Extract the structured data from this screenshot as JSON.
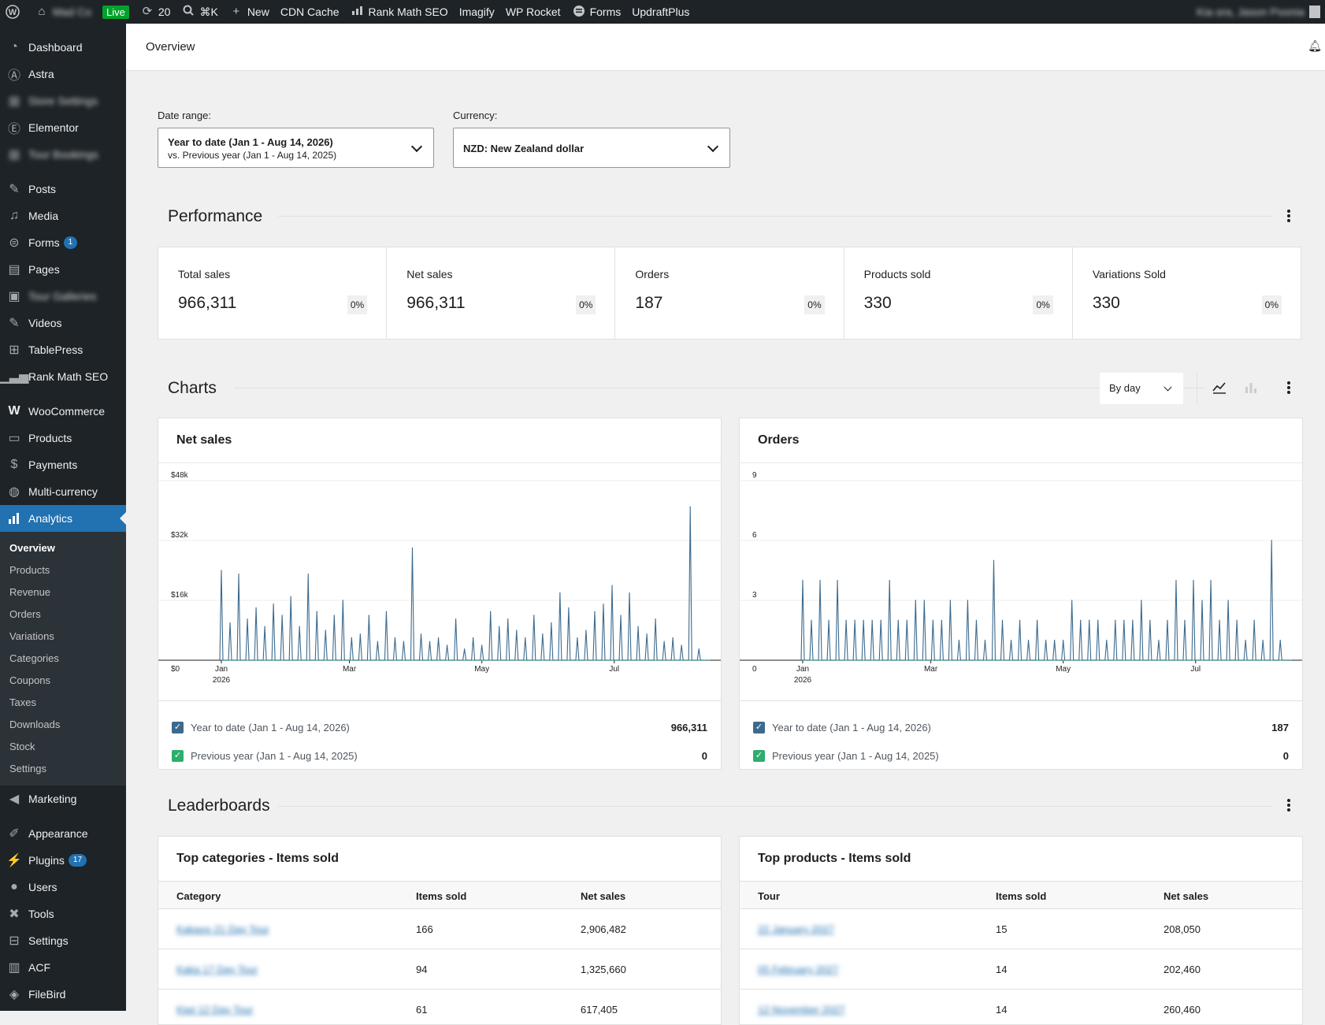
{
  "admin_bar": {
    "site_name": "Mad Co",
    "live_label": "Live",
    "updates_count": "20",
    "search_shortcut": "⌘K",
    "new_label": "New",
    "cdn_cache_label": "CDN Cache",
    "rank_math_label": "Rank Math SEO",
    "imagify_label": "Imagify",
    "wp_rocket_label": "WP Rocket",
    "forms_label": "Forms",
    "updraft_label": "UpdraftPlus",
    "greeting": "Kia ora, Jason Poonia"
  },
  "sidebar": {
    "dashboard": "Dashboard",
    "astra": "Astra",
    "store_settings": "Store Settings",
    "elementor": "Elementor",
    "tour_bookings": "Tour Bookings",
    "posts": "Posts",
    "media": "Media",
    "forms": "Forms",
    "forms_count": "1",
    "pages": "Pages",
    "tour_galleries": "Tour Galleries",
    "videos": "Videos",
    "tablepress": "TablePress",
    "rank_math": "Rank Math SEO",
    "woocommerce": "WooCommerce",
    "products": "Products",
    "payments": "Payments",
    "multi_currency": "Multi-currency",
    "analytics": "Analytics",
    "submenu": [
      "Overview",
      "Products",
      "Revenue",
      "Orders",
      "Variations",
      "Categories",
      "Coupons",
      "Taxes",
      "Downloads",
      "Stock",
      "Settings"
    ],
    "marketing": "Marketing",
    "appearance": "Appearance",
    "plugins": "Plugins",
    "plugins_count": "17",
    "users": "Users",
    "tools": "Tools",
    "settings": "Settings",
    "acf": "ACF",
    "filebird": "FileBird"
  },
  "header": {
    "title": "Overview"
  },
  "filters": {
    "date_range_label": "Date range:",
    "date_range_line1": "Year to date (Jan 1 - Aug 14, 2026)",
    "date_range_line2": "vs. Previous year (Jan 1 - Aug 14, 2025)",
    "currency_label": "Currency:",
    "currency_value": "NZD: New Zealand dollar"
  },
  "performance": {
    "title": "Performance",
    "cards": [
      {
        "label": "Total sales",
        "value": "966,311",
        "delta": "0%"
      },
      {
        "label": "Net sales",
        "value": "966,311",
        "delta": "0%"
      },
      {
        "label": "Orders",
        "value": "187",
        "delta": "0%"
      },
      {
        "label": "Products sold",
        "value": "330",
        "delta": "0%"
      },
      {
        "label": "Variations Sold",
        "value": "330",
        "delta": "0%"
      }
    ]
  },
  "charts": {
    "title": "Charts",
    "interval": "By day",
    "colors": {
      "current": "#3c6a8e",
      "previous": "#2dae6c"
    },
    "net_sales": {
      "title": "Net sales",
      "legend_current": "Year to date (Jan 1 - Aug 14, 2026)",
      "legend_current_value": "966,311",
      "legend_previous": "Previous year (Jan 1 - Aug 14, 2025)",
      "legend_previous_value": "0"
    },
    "orders": {
      "title": "Orders",
      "legend_current": "Year to date (Jan 1 - Aug 14, 2026)",
      "legend_current_value": "187",
      "legend_previous": "Previous year (Jan 1 - Aug 14, 2025)",
      "legend_previous_value": "0"
    }
  },
  "chart_data": [
    {
      "type": "line",
      "title": "Net sales",
      "xlabel": "",
      "ylabel": "",
      "y_ticks": [
        "$0",
        "$16k",
        "$32k",
        "$48k"
      ],
      "ylim": [
        0,
        48000
      ],
      "x_ticks": [
        "Jan 2026",
        "Mar",
        "May",
        "Jul"
      ],
      "x_range": [
        "2026-01-01",
        "2026-08-14"
      ],
      "grid": true,
      "series": [
        {
          "name": "Year to date (Jan 1 - Aug 14, 2026)",
          "color": "#3c6a8e",
          "total": "966,311",
          "peaks": [
            {
              "x": "2026-01-01",
              "y": 24000
            },
            {
              "x": "2026-01-05",
              "y": 10000
            },
            {
              "x": "2026-01-09",
              "y": 23000
            },
            {
              "x": "2026-01-13",
              "y": 11000
            },
            {
              "x": "2026-01-17",
              "y": 14000
            },
            {
              "x": "2026-01-21",
              "y": 9000
            },
            {
              "x": "2026-01-25",
              "y": 15000
            },
            {
              "x": "2026-01-29",
              "y": 12000
            },
            {
              "x": "2026-02-02",
              "y": 17000
            },
            {
              "x": "2026-02-06",
              "y": 9000
            },
            {
              "x": "2026-02-10",
              "y": 23000
            },
            {
              "x": "2026-02-14",
              "y": 13000
            },
            {
              "x": "2026-02-18",
              "y": 8000
            },
            {
              "x": "2026-02-22",
              "y": 12000
            },
            {
              "x": "2026-02-26",
              "y": 16000
            },
            {
              "x": "2026-03-02",
              "y": 6000
            },
            {
              "x": "2026-03-06",
              "y": 7000
            },
            {
              "x": "2026-03-10",
              "y": 12000
            },
            {
              "x": "2026-03-14",
              "y": 5000
            },
            {
              "x": "2026-03-18",
              "y": 13000
            },
            {
              "x": "2026-03-22",
              "y": 6000
            },
            {
              "x": "2026-03-26",
              "y": 5000
            },
            {
              "x": "2026-03-30",
              "y": 30000
            },
            {
              "x": "2026-04-03",
              "y": 7000
            },
            {
              "x": "2026-04-07",
              "y": 5000
            },
            {
              "x": "2026-04-11",
              "y": 6000
            },
            {
              "x": "2026-04-15",
              "y": 4000
            },
            {
              "x": "2026-04-19",
              "y": 11000
            },
            {
              "x": "2026-04-23",
              "y": 3000
            },
            {
              "x": "2026-04-27",
              "y": 6000
            },
            {
              "x": "2026-05-01",
              "y": 4000
            },
            {
              "x": "2026-05-05",
              "y": 13000
            },
            {
              "x": "2026-05-09",
              "y": 9000
            },
            {
              "x": "2026-05-13",
              "y": 11000
            },
            {
              "x": "2026-05-17",
              "y": 8000
            },
            {
              "x": "2026-05-21",
              "y": 6000
            },
            {
              "x": "2026-05-25",
              "y": 12000
            },
            {
              "x": "2026-05-29",
              "y": 7000
            },
            {
              "x": "2026-06-02",
              "y": 10000
            },
            {
              "x": "2026-06-06",
              "y": 18000
            },
            {
              "x": "2026-06-10",
              "y": 14000
            },
            {
              "x": "2026-06-14",
              "y": 6000
            },
            {
              "x": "2026-06-18",
              "y": 8000
            },
            {
              "x": "2026-06-22",
              "y": 13000
            },
            {
              "x": "2026-06-26",
              "y": 15000
            },
            {
              "x": "2026-06-30",
              "y": 20000
            },
            {
              "x": "2026-07-04",
              "y": 12000
            },
            {
              "x": "2026-07-08",
              "y": 18000
            },
            {
              "x": "2026-07-12",
              "y": 9000
            },
            {
              "x": "2026-07-16",
              "y": 7000
            },
            {
              "x": "2026-07-20",
              "y": 11000
            },
            {
              "x": "2026-07-24",
              "y": 5000
            },
            {
              "x": "2026-07-28",
              "y": 6000
            },
            {
              "x": "2026-08-01",
              "y": 4000
            },
            {
              "x": "2026-08-05",
              "y": 41000
            },
            {
              "x": "2026-08-09",
              "y": 3000
            },
            {
              "x": "2026-08-13",
              "y": 0
            }
          ]
        },
        {
          "name": "Previous year (Jan 1 - Aug 14, 2025)",
          "color": "#2dae6c",
          "total": "0",
          "constant": 0
        }
      ]
    },
    {
      "type": "line",
      "title": "Orders",
      "xlabel": "",
      "ylabel": "",
      "y_ticks": [
        "0",
        "3",
        "6",
        "9"
      ],
      "ylim": [
        0,
        9
      ],
      "x_ticks": [
        "Jan 2026",
        "Mar",
        "May",
        "Jul"
      ],
      "x_range": [
        "2026-01-01",
        "2026-08-14"
      ],
      "grid": true,
      "series": [
        {
          "name": "Year to date (Jan 1 - Aug 14, 2026)",
          "color": "#3c6a8e",
          "total": "187",
          "peaks": [
            {
              "x": "2026-01-01",
              "y": 4
            },
            {
              "x": "2026-01-05",
              "y": 2
            },
            {
              "x": "2026-01-09",
              "y": 4
            },
            {
              "x": "2026-01-13",
              "y": 2
            },
            {
              "x": "2026-01-17",
              "y": 4
            },
            {
              "x": "2026-01-21",
              "y": 2
            },
            {
              "x": "2026-01-25",
              "y": 2
            },
            {
              "x": "2026-01-29",
              "y": 2
            },
            {
              "x": "2026-02-02",
              "y": 2
            },
            {
              "x": "2026-02-06",
              "y": 2
            },
            {
              "x": "2026-02-10",
              "y": 4
            },
            {
              "x": "2026-02-14",
              "y": 2
            },
            {
              "x": "2026-02-18",
              "y": 2
            },
            {
              "x": "2026-02-22",
              "y": 3
            },
            {
              "x": "2026-02-26",
              "y": 3
            },
            {
              "x": "2026-03-02",
              "y": 2
            },
            {
              "x": "2026-03-06",
              "y": 2
            },
            {
              "x": "2026-03-10",
              "y": 3
            },
            {
              "x": "2026-03-14",
              "y": 1
            },
            {
              "x": "2026-03-18",
              "y": 3
            },
            {
              "x": "2026-03-22",
              "y": 2
            },
            {
              "x": "2026-03-26",
              "y": 1
            },
            {
              "x": "2026-03-30",
              "y": 5
            },
            {
              "x": "2026-04-03",
              "y": 2
            },
            {
              "x": "2026-04-07",
              "y": 1
            },
            {
              "x": "2026-04-11",
              "y": 2
            },
            {
              "x": "2026-04-15",
              "y": 1
            },
            {
              "x": "2026-04-19",
              "y": 2
            },
            {
              "x": "2026-04-23",
              "y": 1
            },
            {
              "x": "2026-04-27",
              "y": 1
            },
            {
              "x": "2026-05-01",
              "y": 1
            },
            {
              "x": "2026-05-05",
              "y": 3
            },
            {
              "x": "2026-05-09",
              "y": 2
            },
            {
              "x": "2026-05-13",
              "y": 2
            },
            {
              "x": "2026-05-17",
              "y": 2
            },
            {
              "x": "2026-05-21",
              "y": 1
            },
            {
              "x": "2026-05-25",
              "y": 2
            },
            {
              "x": "2026-05-29",
              "y": 2
            },
            {
              "x": "2026-06-02",
              "y": 2
            },
            {
              "x": "2026-06-06",
              "y": 3
            },
            {
              "x": "2026-06-10",
              "y": 2
            },
            {
              "x": "2026-06-14",
              "y": 1
            },
            {
              "x": "2026-06-18",
              "y": 2
            },
            {
              "x": "2026-06-22",
              "y": 4
            },
            {
              "x": "2026-06-26",
              "y": 2
            },
            {
              "x": "2026-06-30",
              "y": 4
            },
            {
              "x": "2026-07-04",
              "y": 3
            },
            {
              "x": "2026-07-08",
              "y": 4
            },
            {
              "x": "2026-07-12",
              "y": 2
            },
            {
              "x": "2026-07-16",
              "y": 3
            },
            {
              "x": "2026-07-20",
              "y": 2
            },
            {
              "x": "2026-07-24",
              "y": 1
            },
            {
              "x": "2026-07-28",
              "y": 2
            },
            {
              "x": "2026-08-01",
              "y": 1
            },
            {
              "x": "2026-08-05",
              "y": 6
            },
            {
              "x": "2026-08-09",
              "y": 1
            },
            {
              "x": "2026-08-13",
              "y": 0
            }
          ]
        },
        {
          "name": "Previous year (Jan 1 - Aug 14, 2025)",
          "color": "#2dae6c",
          "total": "0",
          "constant": 0
        }
      ]
    }
  ],
  "leaderboards": {
    "title": "Leaderboards",
    "top_categories": {
      "title": "Top categories - Items sold",
      "columns": [
        "Category",
        "Items sold",
        "Net sales"
      ],
      "rows": [
        {
          "name": "Kakaoo 21 Day Tour",
          "items": "166",
          "net": "2,906,482"
        },
        {
          "name": "Kaka 17 Day Tour",
          "items": "94",
          "net": "1,325,660"
        },
        {
          "name": "Kiwi 12 Day Tour",
          "items": "61",
          "net": "617,405"
        }
      ]
    },
    "top_products": {
      "title": "Top products - Items sold",
      "columns": [
        "Tour",
        "Items sold",
        "Net sales"
      ],
      "rows": [
        {
          "name": "22 January 2027",
          "items": "15",
          "net": "208,050"
        },
        {
          "name": "05 February 2027",
          "items": "14",
          "net": "202,460"
        },
        {
          "name": "12 November 2027",
          "items": "14",
          "net": "260,460"
        }
      ]
    }
  }
}
